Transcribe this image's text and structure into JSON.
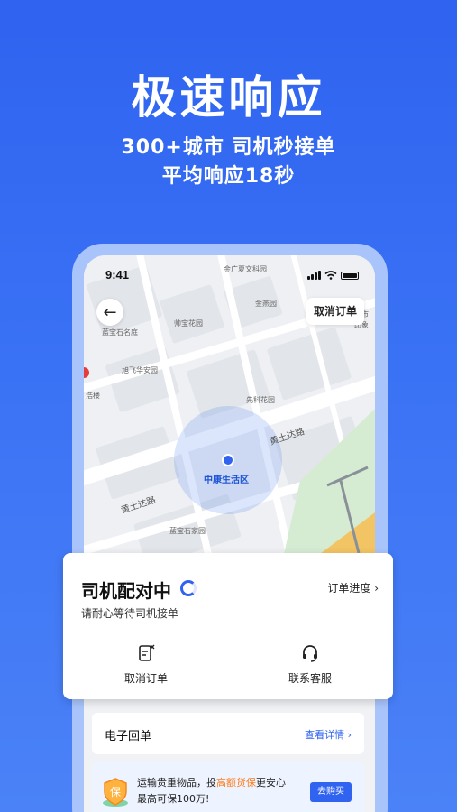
{
  "hero": {
    "title": "极速响应",
    "line1": "300+城市 司机秒接单",
    "line2": "平均响应18秒"
  },
  "status_bar": {
    "time": "9:41"
  },
  "map": {
    "cancel_order_label": "取消订单",
    "labels": {
      "l1": "金广夏文科园",
      "l2": "蓝宝石名庭",
      "l3": "帅宝花园",
      "l4": "金燕园",
      "l5": "旭飞华安园",
      "l6": "浩楼",
      "l7": "先科花园",
      "l8": "黄土达路",
      "l9": "中康生活区",
      "l10": "黄土达路",
      "l11": "蓝宝石家园",
      "l12": "超市",
      "l13": "印象"
    }
  },
  "order_card": {
    "title": "司机配对中",
    "subtitle": "请耐心等待司机接单",
    "progress_link": "订单进度 ›",
    "cancel_label": "取消订单",
    "support_label": "联系客服"
  },
  "receipt": {
    "label": "电子回单",
    "link": "查看详情 ›"
  },
  "promo": {
    "text_before": "运输贵重物品，投",
    "text_highlight": "高额货保",
    "text_after": "更安心",
    "line2": "最高可保100万!",
    "button": "去购买",
    "badge": "保"
  },
  "colors": {
    "brand": "#2f63f0",
    "highlight": "#ff7a1a"
  }
}
